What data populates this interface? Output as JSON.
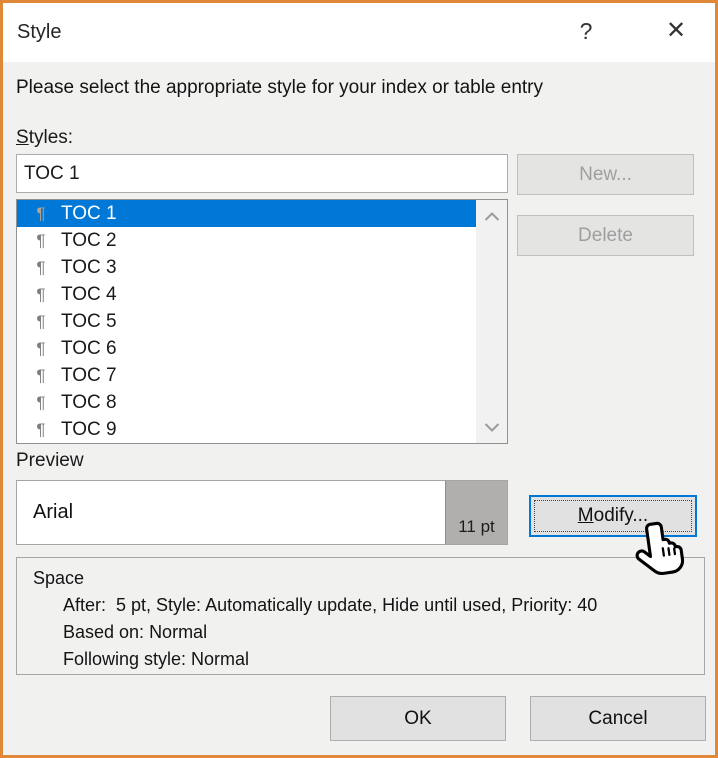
{
  "dialog": {
    "title": "Style",
    "instruction": "Please select the appropriate style for your index or table entry"
  },
  "icons": {
    "help": "?",
    "close": "✕",
    "pilcrow": "¶"
  },
  "styles": {
    "label_accel": "S",
    "label_rest": "tyles:",
    "input_value": "TOC 1",
    "items": [
      "TOC 1",
      "TOC 2",
      "TOC 3",
      "TOC 4",
      "TOC 5",
      "TOC 6",
      "TOC 7",
      "TOC 8",
      "TOC 9"
    ],
    "selected_index": 0
  },
  "buttons": {
    "new": "New...",
    "delete": "Delete",
    "modify_accel": "M",
    "modify_rest": "odify...",
    "ok": "OK",
    "cancel": "Cancel"
  },
  "preview": {
    "label": "Preview",
    "font_name": "Arial",
    "font_size": "11 pt"
  },
  "description": {
    "style_name": "Space",
    "line1": "After:  5 pt, Style: Automatically update, Hide until used, Priority: 40",
    "line2": "Based on: Normal",
    "line3": "Following style: Normal"
  },
  "colors": {
    "dialog_border": "#e0883a",
    "selection_blue": "#0078d7",
    "focus_border": "#0078d7",
    "body_background": "#f1f1f0",
    "preview_size_gray": "#b1afad"
  }
}
